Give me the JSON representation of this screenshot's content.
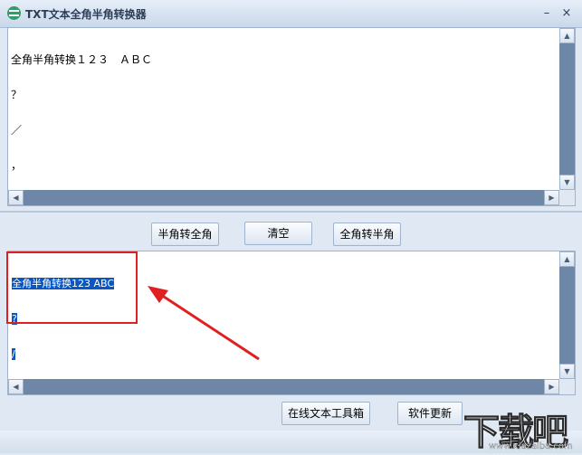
{
  "window": {
    "title": "TXT文本全角半角转换器",
    "icon": "app-logo-icon",
    "minimize_glyph": "–",
    "close_glyph": "×"
  },
  "input_box": {
    "lines": [
      "全角半角转换１２３　ＡＢＣ",
      "？",
      "／",
      "，",
      "。"
    ]
  },
  "buttons": {
    "half_to_full": "半角转全角",
    "clear": "清空",
    "full_to_half": "全角转半角",
    "online_tools": "在线文本工具箱",
    "update": "软件更新"
  },
  "output_box": {
    "lines": [
      "全角半角转换123 ABC",
      "?",
      "/",
      ",",
      "."
    ]
  },
  "scroll_glyphs": {
    "up": "▲",
    "down": "▼",
    "left": "◀",
    "right": "▶"
  },
  "annotation": {
    "color": "#e02020"
  },
  "watermark": {
    "text": "下载吧",
    "url": "www.xiazaiba.com"
  }
}
